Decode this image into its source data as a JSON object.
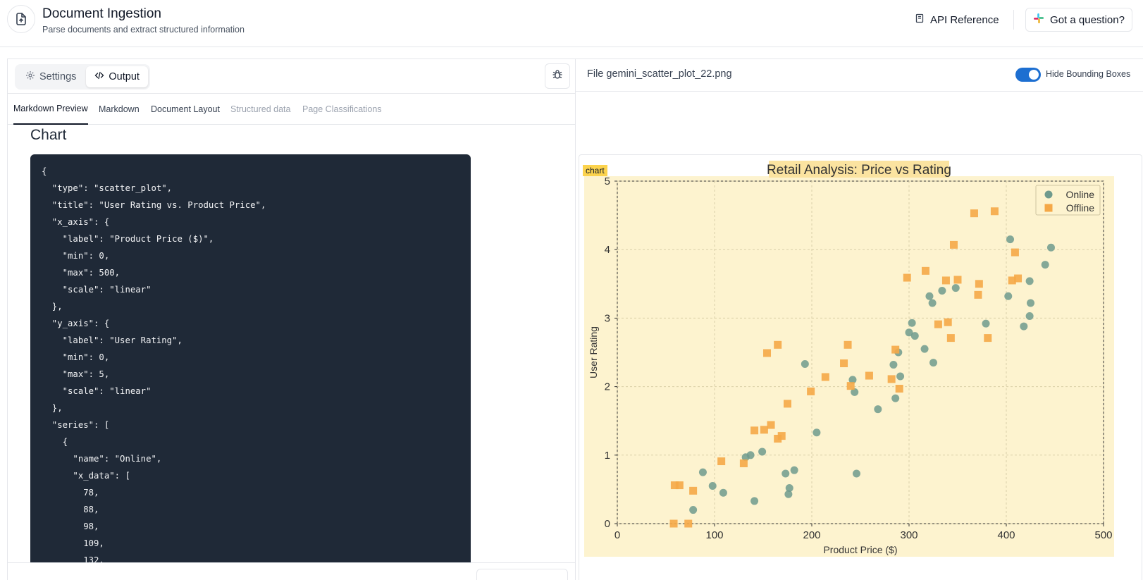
{
  "header": {
    "title": "Document Ingestion",
    "subtitle": "Parse documents and extract structured information",
    "api_reference": "API Reference",
    "question": "Got a question?"
  },
  "left": {
    "seg_settings": "Settings",
    "seg_output": "Output",
    "tabs": [
      "Markdown Preview",
      "Markdown",
      "Document Layout",
      "Structured data",
      "Page Classifications"
    ],
    "section_heading": "Chart",
    "code_lines": [
      "{",
      "  \"type\": \"scatter_plot\",",
      "  \"title\": \"User Rating vs. Product Price\",",
      "  \"x_axis\": {",
      "    \"label\": \"Product Price ($)\",",
      "    \"min\": 0,",
      "    \"max\": 500,",
      "    \"scale\": \"linear\"",
      "  },",
      "  \"y_axis\": {",
      "    \"label\": \"User Rating\",",
      "    \"min\": 0,",
      "    \"max\": 5,",
      "    \"scale\": \"linear\"",
      "  },",
      "  \"series\": [",
      "    {",
      "      \"name\": \"Online\",",
      "      \"x_data\": [",
      "        78,",
      "        88,",
      "        98,",
      "        109,",
      "        132,"
    ]
  },
  "right": {
    "file_label": "File gemini_scatter_plot_22.png",
    "toggle_label": "Hide Bounding Boxes",
    "chart_tag": "chart"
  },
  "chart_data": {
    "type": "scatter",
    "title": "Retail Analysis: Price vs Rating",
    "xlabel": "Product Price ($)",
    "ylabel": "User Rating",
    "xlim": [
      0,
      500
    ],
    "ylim": [
      0,
      5
    ],
    "xticks": [
      0,
      100,
      200,
      300,
      400,
      500
    ],
    "yticks": [
      0,
      1,
      2,
      3,
      4,
      5
    ],
    "grid": true,
    "legend_position": "top-right",
    "series": [
      {
        "name": "Online",
        "color": "#6f9a8d",
        "marker": "circle",
        "points": [
          [
            78,
            0.2
          ],
          [
            88,
            0.75
          ],
          [
            98,
            0.55
          ],
          [
            109,
            0.45
          ],
          [
            132,
            0.97
          ],
          [
            137,
            1.0
          ],
          [
            141,
            0.33
          ],
          [
            149,
            1.05
          ],
          [
            173,
            0.73
          ],
          [
            176,
            0.43
          ],
          [
            177,
            0.52
          ],
          [
            182,
            0.78
          ],
          [
            193,
            2.33
          ],
          [
            205,
            1.33
          ],
          [
            242,
            2.1
          ],
          [
            244,
            1.92
          ],
          [
            246,
            0.73
          ],
          [
            268,
            1.67
          ],
          [
            284,
            2.32
          ],
          [
            286,
            1.83
          ],
          [
            289,
            2.5
          ],
          [
            291,
            2.15
          ],
          [
            300,
            2.79
          ],
          [
            303,
            2.93
          ],
          [
            306,
            2.74
          ],
          [
            316,
            2.55
          ],
          [
            321,
            3.32
          ],
          [
            324,
            3.22
          ],
          [
            325,
            2.35
          ],
          [
            334,
            3.4
          ],
          [
            348,
            3.44
          ],
          [
            379,
            2.92
          ],
          [
            402,
            3.32
          ],
          [
            404,
            4.15
          ],
          [
            418,
            2.88
          ],
          [
            424,
            3.54
          ],
          [
            424,
            3.03
          ],
          [
            425,
            3.22
          ],
          [
            440,
            3.78
          ],
          [
            446,
            4.03
          ]
        ]
      },
      {
        "name": "Offline",
        "color": "#f5a847",
        "marker": "square",
        "points": [
          [
            58,
            0.0
          ],
          [
            59,
            0.56
          ],
          [
            64,
            0.56
          ],
          [
            73,
            0.0
          ],
          [
            78,
            0.48
          ],
          [
            107,
            0.91
          ],
          [
            130,
            0.88
          ],
          [
            141,
            1.36
          ],
          [
            151,
            1.37
          ],
          [
            154,
            2.49
          ],
          [
            158,
            1.44
          ],
          [
            165,
            1.24
          ],
          [
            165,
            2.61
          ],
          [
            169,
            1.28
          ],
          [
            175,
            1.75
          ],
          [
            199,
            1.93
          ],
          [
            214,
            2.14
          ],
          [
            233,
            2.34
          ],
          [
            237,
            2.61
          ],
          [
            240,
            2.01
          ],
          [
            259,
            2.16
          ],
          [
            282,
            2.11
          ],
          [
            286,
            2.54
          ],
          [
            290,
            1.97
          ],
          [
            298,
            3.59
          ],
          [
            317,
            3.69
          ],
          [
            330,
            2.91
          ],
          [
            338,
            3.55
          ],
          [
            340,
            2.94
          ],
          [
            343,
            2.71
          ],
          [
            346,
            4.07
          ],
          [
            350,
            3.56
          ],
          [
            367,
            4.53
          ],
          [
            371,
            3.34
          ],
          [
            372,
            3.5
          ],
          [
            381,
            2.71
          ],
          [
            388,
            4.56
          ],
          [
            406,
            3.55
          ],
          [
            409,
            3.96
          ],
          [
            412,
            3.58
          ]
        ]
      }
    ]
  }
}
